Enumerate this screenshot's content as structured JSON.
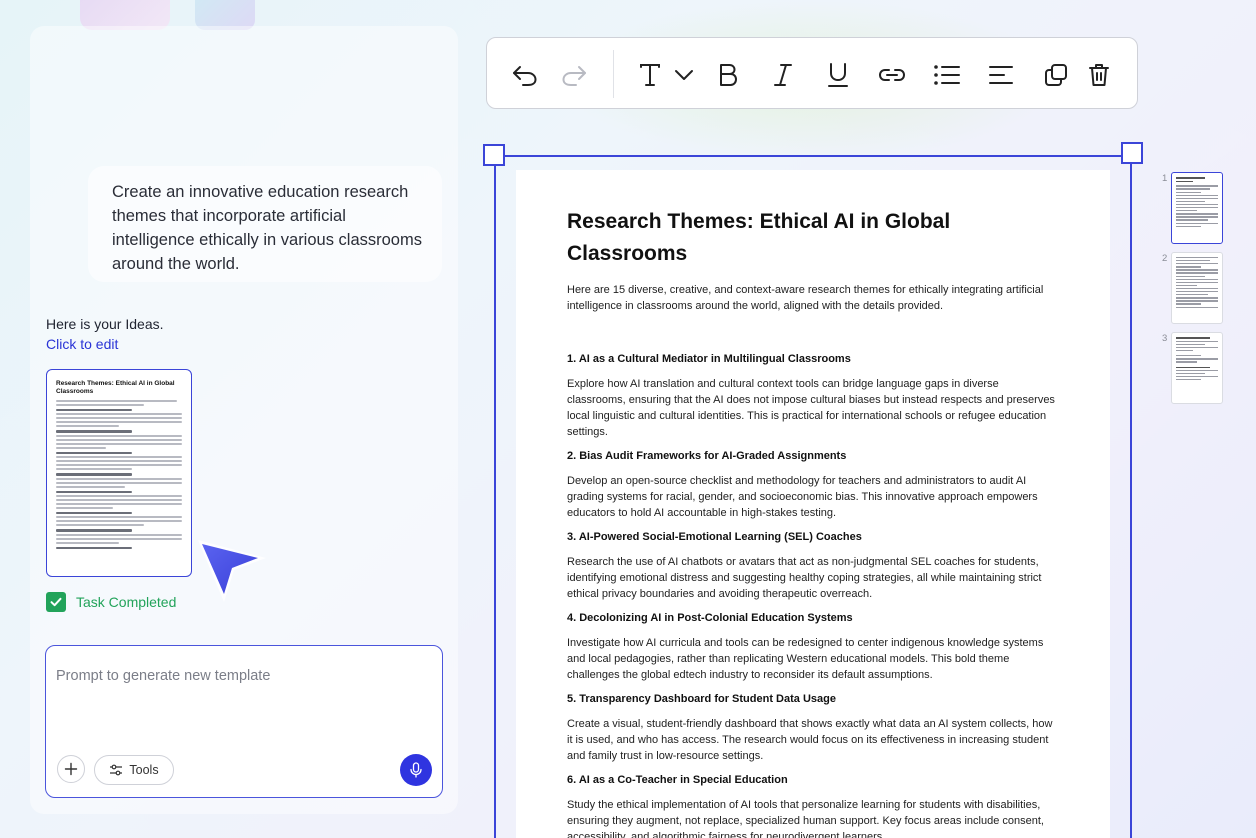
{
  "chat": {
    "user_message": "Create an innovative education research themes that incorporate artificial intelligence ethically in various classrooms around the world.",
    "ideas_text": "Here is your Ideas.",
    "edit_link": "Click to edit",
    "task_status": "Task Completed",
    "prompt_placeholder": "Prompt to generate new template",
    "tools_label": "Tools"
  },
  "thumbnail": {
    "title": "Research Themes: Ethical AI in Global Classrooms"
  },
  "toolbar": {
    "icons": [
      "undo-icon",
      "redo-icon",
      "text-icon",
      "chevron-down-icon",
      "bold-icon",
      "italic-icon",
      "underline-icon",
      "link-icon",
      "list-icon",
      "align-icon",
      "duplicate-icon",
      "delete-icon"
    ]
  },
  "document": {
    "title": "Research Themes: Ethical AI in Global Classrooms",
    "intro": "Here are 15 diverse, creative, and context-aware research themes for ethically integrating artificial intelligence in classrooms around the world, aligned with the details provided.",
    "sections": [
      {
        "heading": "1. AI as a Cultural Mediator in Multilingual Classrooms",
        "body": "Explore how AI translation and cultural context tools can bridge language gaps in diverse classrooms, ensuring that the AI does not impose cultural biases but instead respects and preserves local linguistic and cultural identities. This is practical for international schools or refugee education settings."
      },
      {
        "heading": "2. Bias Audit Frameworks for AI-Graded Assignments",
        "body": "Develop an open-source checklist and methodology for teachers and administrators to audit AI grading systems for racial, gender, and socioeconomic bias. This innovative approach empowers educators to hold AI accountable in high-stakes testing."
      },
      {
        "heading": "3. AI-Powered Social-Emotional Learning (SEL) Coaches",
        "body": "Research the use of AI chatbots or avatars that act as non-judgmental SEL coaches for students, identifying emotional distress and suggesting healthy coping strategies, all while maintaining strict ethical privacy boundaries and avoiding therapeutic overreach."
      },
      {
        "heading": "4. Decolonizing AI in Post-Colonial Education Systems",
        "body": "Investigate how AI curricula and tools can be redesigned to center indigenous knowledge systems and local pedagogies, rather than replicating Western educational models. This bold theme challenges the global edtech industry to reconsider its default assumptions."
      },
      {
        "heading": "5. Transparency Dashboard for Student Data Usage",
        "body": "Create a visual, student-friendly dashboard that shows exactly what data an AI system collects, how it is used, and who has access. The research would focus on its effectiveness in increasing student and family trust in low-resource settings."
      },
      {
        "heading": "6. AI as a Co-Teacher in Special Education",
        "body": "Study the ethical implementation of AI tools that personalize learning for students with disabilities, ensuring they augment, not replace, specialized human support. Key focus areas include consent, accessibility, and algorithmic fairness for neurodivergent learners."
      }
    ]
  },
  "pages": {
    "numbers": [
      "1",
      "2",
      "3"
    ],
    "active": "1"
  },
  "colors": {
    "accent": "#3b45d8",
    "success": "#22a35a",
    "mic": "#2f34e0"
  }
}
